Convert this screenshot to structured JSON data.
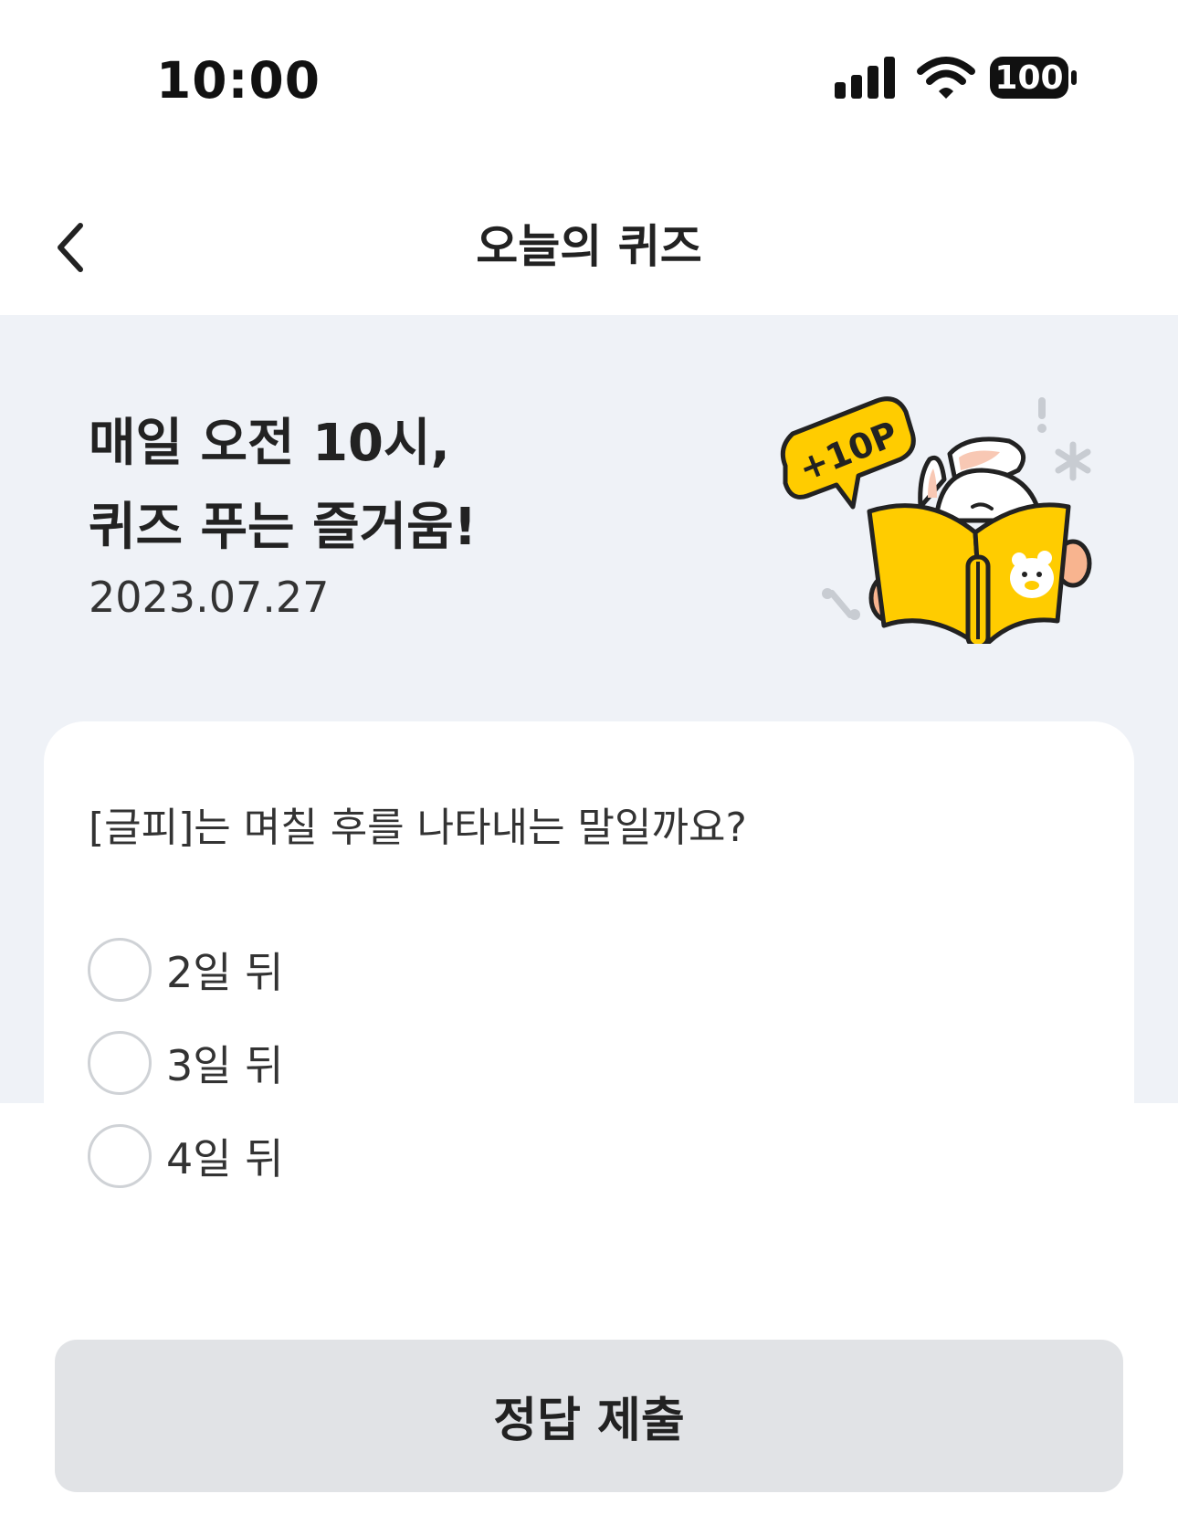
{
  "status_bar": {
    "time": "10:00",
    "battery": "100",
    "icons": [
      "signal-icon",
      "wifi-icon",
      "battery-icon"
    ]
  },
  "nav": {
    "title": "오늘의 퀴즈",
    "back_icon": "chevron-left-icon"
  },
  "hero": {
    "title_line1": "매일 오전 10시,",
    "title_line2": "퀴즈 푸는 즐거움!",
    "date": "2023.07.27",
    "illustration": {
      "badge_text": "+10P",
      "description_icon": "rabbit-reading-book-illustration"
    }
  },
  "quiz": {
    "question": "[글피]는 며칠 후를 나타내는 말일까요?",
    "options": [
      {
        "label": "2일 뒤",
        "selected": false
      },
      {
        "label": "3일 뒤",
        "selected": false
      },
      {
        "label": "4일 뒤",
        "selected": false
      }
    ]
  },
  "submit": {
    "label": "정답 제출"
  },
  "colors": {
    "hero_background": "#eff2f7",
    "accent_yellow": "#ffcc00",
    "button_background": "#e1e3e6",
    "radio_border": "#cfd2d6"
  }
}
